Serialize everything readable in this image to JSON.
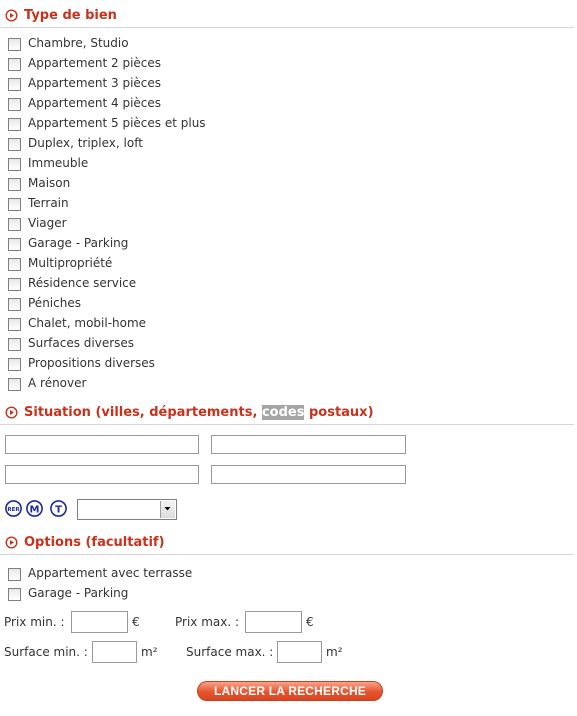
{
  "type_de_bien": {
    "title": "Type de bien",
    "items": [
      {
        "label": "Chambre, Studio",
        "checked": false
      },
      {
        "label": "Appartement 2 pièces",
        "checked": false
      },
      {
        "label": "Appartement 3 pièces",
        "checked": false
      },
      {
        "label": "Appartement 4 pièces",
        "checked": false
      },
      {
        "label": "Appartement 5 pièces et plus",
        "checked": false
      },
      {
        "label": "Duplex, triplex, loft",
        "checked": false
      },
      {
        "label": "Immeuble",
        "checked": false
      },
      {
        "label": "Maison",
        "checked": false
      },
      {
        "label": "Terrain",
        "checked": false
      },
      {
        "label": "Viager",
        "checked": false
      },
      {
        "label": "Garage - Parking",
        "checked": false
      },
      {
        "label": "Multipropriété",
        "checked": false
      },
      {
        "label": "Résidence service",
        "checked": false
      },
      {
        "label": "Péniches",
        "checked": false
      },
      {
        "label": "Chalet, mobil-home",
        "checked": false
      },
      {
        "label": "Surfaces diverses",
        "checked": false
      },
      {
        "label": "Propositions diverses",
        "checked": false
      },
      {
        "label": "A rénover",
        "checked": false
      }
    ]
  },
  "situation": {
    "title_before": "Situation (villes, départements, ",
    "title_highlight": "codes",
    "title_after": " postaux)",
    "fields": [
      {
        "value": "",
        "placeholder": ""
      },
      {
        "value": "",
        "placeholder": ""
      },
      {
        "value": "",
        "placeholder": ""
      },
      {
        "value": "",
        "placeholder": ""
      }
    ],
    "transport": {
      "rer_icon": "RER",
      "metro_icon": "M",
      "tram_icon": "T",
      "selected_value": ""
    }
  },
  "options": {
    "title": "Options (facultatif)",
    "items": [
      {
        "label": "Appartement avec terrasse",
        "checked": false
      },
      {
        "label": "Garage - Parking",
        "checked": false
      }
    ],
    "prix_min_label": "Prix min. :",
    "prix_max_label": "Prix max. :",
    "currency": "€",
    "surface_min_label": "Surface min. :",
    "surface_max_label": "Surface max. :",
    "area_unit": "m²",
    "prix_min_value": "",
    "prix_max_value": "",
    "surface_min_value": "",
    "surface_max_value": ""
  },
  "submit": {
    "label": "LANCER LA RECHERCHE"
  },
  "colors": {
    "section_title": "#c8321c",
    "button": "#e5542f",
    "transport_icons": "#1d2c9b"
  },
  "icons": {
    "section_bullet": "play-circle-icon"
  }
}
